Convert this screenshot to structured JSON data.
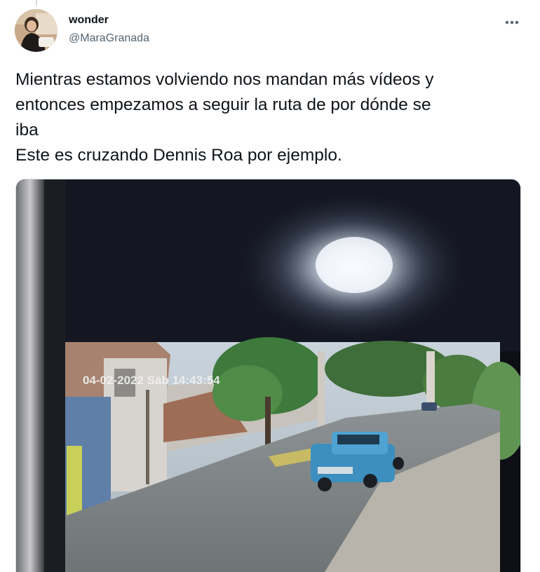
{
  "tweet": {
    "author_name": "wonder",
    "author_handle": "@MaraGranada",
    "text": "Mientras estamos volviendo nos mandan más vídeos y\nentonces empezamos a seguir la ruta de por dónde se\niba\nEste es cruzando Dennis Roa por ejemplo.",
    "more_icon": "more-horizontal-icon"
  },
  "media": {
    "cctv_timestamp": "04-02-2022 Sáb 14:43:54"
  }
}
